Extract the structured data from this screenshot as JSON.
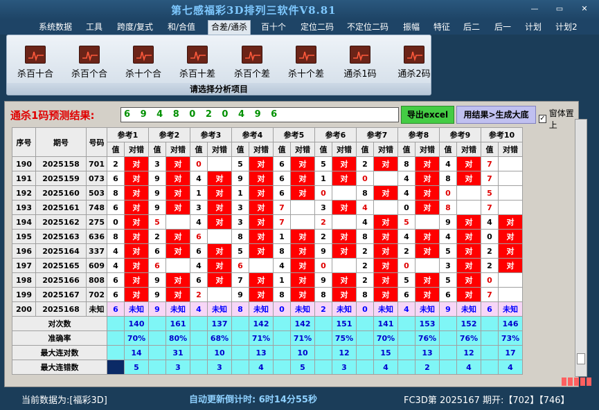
{
  "window": {
    "title": "第七感福彩3D排列三软件V8.81",
    "min_btn": "—",
    "restore_btn": "▭",
    "close_btn": "✕"
  },
  "menu": [
    "系统数据",
    "工具",
    "跨度/复式",
    "和/合值",
    "合差/通杀",
    "百十个",
    "定位二码",
    "不定位二码",
    "振幅",
    "特征",
    "后二",
    "后一",
    "计划",
    "计划2"
  ],
  "menu_active": 4,
  "ribbon": {
    "buttons": [
      "杀百十合",
      "杀百个合",
      "杀十个合",
      "杀百十差",
      "杀百个差",
      "杀十个差",
      "通杀1码",
      "通杀2码"
    ],
    "caption": "请选择分析项目"
  },
  "prediction": {
    "label": "通杀1码预测结果:",
    "value": "6 9 4 8 0 2 0 4 9 6"
  },
  "buttons": {
    "export": "导出excel",
    "generate": "用结果>生成大底",
    "topmost": "窗体置上"
  },
  "table": {
    "headers": {
      "seq": "序号",
      "period": "期号",
      "number": "号码",
      "refs": [
        "参考1",
        "参考2",
        "参考3",
        "参考4",
        "参考5",
        "参考6",
        "参考7",
        "参考8",
        "参考9",
        "参考10"
      ],
      "val": "值",
      "hit": "对错"
    },
    "rows": [
      {
        "seq": "190",
        "period": "2025158",
        "num": "701",
        "v": [
          "2",
          "3",
          "0",
          "5",
          "6",
          "5",
          "2",
          "8",
          "4",
          "7"
        ],
        "ok": [
          1,
          1,
          0,
          1,
          1,
          1,
          1,
          1,
          1,
          0
        ],
        "nv": [
          0,
          0,
          1,
          0,
          0,
          0,
          0,
          0,
          0,
          1
        ]
      },
      {
        "seq": "191",
        "period": "2025159",
        "num": "073",
        "v": [
          "6",
          "9",
          "4",
          "9",
          "6",
          "1",
          "0",
          "4",
          "8",
          "7"
        ],
        "ok": [
          1,
          1,
          1,
          1,
          1,
          1,
          0,
          1,
          1,
          0
        ],
        "nv": [
          0,
          0,
          0,
          0,
          0,
          0,
          1,
          0,
          0,
          1
        ]
      },
      {
        "seq": "192",
        "period": "2025160",
        "num": "503",
        "v": [
          "8",
          "9",
          "1",
          "1",
          "6",
          "0",
          "8",
          "4",
          "0",
          "5"
        ],
        "ok": [
          1,
          1,
          1,
          1,
          1,
          0,
          1,
          1,
          0,
          0
        ],
        "nv": [
          0,
          0,
          0,
          0,
          0,
          1,
          0,
          0,
          1,
          1
        ]
      },
      {
        "seq": "193",
        "period": "2025161",
        "num": "748",
        "v": [
          "6",
          "9",
          "3",
          "3",
          "7",
          "3",
          "4",
          "0",
          "8",
          "7"
        ],
        "ok": [
          1,
          1,
          1,
          1,
          0,
          1,
          0,
          1,
          0,
          0
        ],
        "nv": [
          0,
          0,
          0,
          0,
          1,
          0,
          1,
          0,
          1,
          1
        ]
      },
      {
        "seq": "194",
        "period": "2025162",
        "num": "275",
        "v": [
          "0",
          "5",
          "4",
          "3",
          "7",
          "2",
          "4",
          "5",
          "9",
          "4"
        ],
        "ok": [
          1,
          0,
          1,
          1,
          0,
          0,
          1,
          0,
          1,
          1
        ],
        "nv": [
          0,
          1,
          0,
          0,
          1,
          1,
          0,
          1,
          0,
          0
        ]
      },
      {
        "seq": "195",
        "period": "2025163",
        "num": "636",
        "v": [
          "8",
          "2",
          "6",
          "8",
          "1",
          "2",
          "8",
          "4",
          "4",
          "0"
        ],
        "ok": [
          1,
          1,
          0,
          1,
          1,
          1,
          1,
          1,
          1,
          1
        ],
        "nv": [
          0,
          0,
          1,
          0,
          0,
          0,
          0,
          0,
          0,
          0
        ]
      },
      {
        "seq": "196",
        "period": "2025164",
        "num": "337",
        "v": [
          "4",
          "6",
          "6",
          "5",
          "8",
          "9",
          "2",
          "2",
          "5",
          "2"
        ],
        "ok": [
          1,
          1,
          1,
          1,
          1,
          1,
          1,
          1,
          1,
          1
        ],
        "nv": [
          0,
          0,
          0,
          0,
          0,
          0,
          0,
          0,
          0,
          0
        ]
      },
      {
        "seq": "197",
        "period": "2025165",
        "num": "609",
        "v": [
          "4",
          "6",
          "4",
          "6",
          "4",
          "0",
          "2",
          "0",
          "3",
          "2"
        ],
        "ok": [
          1,
          0,
          1,
          0,
          1,
          0,
          1,
          0,
          1,
          1
        ],
        "nv": [
          0,
          1,
          0,
          1,
          0,
          1,
          0,
          1,
          0,
          0
        ]
      },
      {
        "seq": "198",
        "period": "2025166",
        "num": "808",
        "v": [
          "6",
          "9",
          "6",
          "7",
          "1",
          "9",
          "2",
          "5",
          "5",
          "0"
        ],
        "ok": [
          1,
          1,
          1,
          1,
          1,
          1,
          1,
          1,
          1,
          0
        ],
        "nv": [
          0,
          0,
          0,
          0,
          0,
          0,
          0,
          0,
          0,
          1
        ]
      },
      {
        "seq": "199",
        "period": "2025167",
        "num": "702",
        "v": [
          "6",
          "9",
          "2",
          "9",
          "8",
          "8",
          "8",
          "6",
          "6",
          "7"
        ],
        "ok": [
          1,
          1,
          0,
          1,
          1,
          1,
          1,
          1,
          1,
          0
        ],
        "nv": [
          0,
          0,
          1,
          0,
          0,
          0,
          0,
          0,
          0,
          1
        ]
      }
    ],
    "ok_text": "对",
    "future": {
      "seq": "200",
      "period": "2025168",
      "num": "未知",
      "v": [
        "6",
        "9",
        "4",
        "8",
        "0",
        "2",
        "0",
        "4",
        "9",
        "6"
      ],
      "unknown": "未知"
    },
    "stats": [
      {
        "label": "对次数",
        "v": [
          "140",
          "161",
          "137",
          "142",
          "142",
          "151",
          "141",
          "153",
          "152",
          "146"
        ]
      },
      {
        "label": "准确率",
        "v": [
          "70%",
          "80%",
          "68%",
          "71%",
          "71%",
          "75%",
          "70%",
          "76%",
          "76%",
          "73%"
        ]
      },
      {
        "label": "最大连对数",
        "v": [
          "14",
          "31",
          "10",
          "13",
          "10",
          "12",
          "15",
          "13",
          "12",
          "17"
        ]
      },
      {
        "label": "最大连错数",
        "v": [
          "5",
          "3",
          "3",
          "4",
          "5",
          "3",
          "4",
          "2",
          "4",
          "4"
        ]
      }
    ]
  },
  "status": {
    "left": "当前数据为:[福彩3D]",
    "mid": "自动更新倒计时: 6时14分55秒",
    "right": "FC3D第 2025167 期开:【702】【746】"
  }
}
